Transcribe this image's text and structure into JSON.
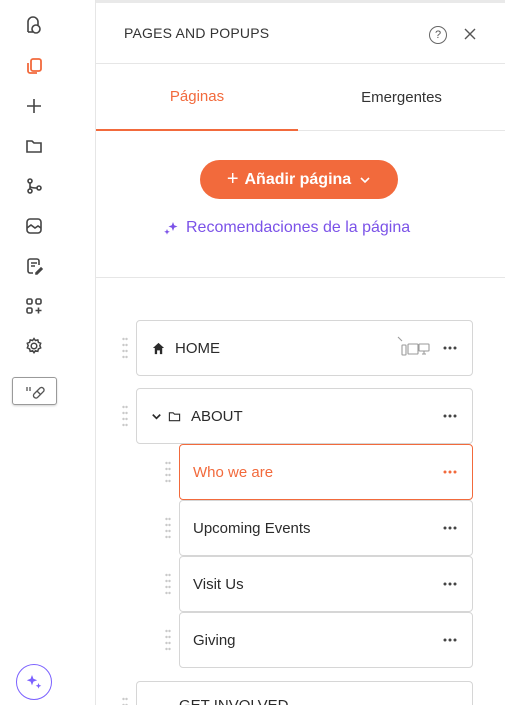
{
  "panel": {
    "title": "PAGES AND POPUPS",
    "help_glyph": "?",
    "tabs": [
      {
        "label": "Páginas",
        "active": true
      },
      {
        "label": "Emergentes",
        "active": false
      }
    ],
    "add_page_label": "Añadir página",
    "add_page_plus": "+",
    "recommendations_label": "Recomendaciones de la página"
  },
  "rail": {
    "icons": [
      "design-icon",
      "pages-icon",
      "add-icon",
      "folder-icon",
      "flow-icon",
      "media-icon",
      "blog-icon",
      "apps-icon",
      "settings-icon"
    ],
    "active_icon": "pages-icon",
    "plugin_chip_icon": "plugin-chip-icon",
    "ai_icon": "sparkle-icon"
  },
  "pages": [
    {
      "label": "HOME",
      "type": "home",
      "level": 0
    },
    {
      "label": "ABOUT",
      "type": "folder",
      "level": 0,
      "expanded": true
    },
    {
      "label": "Who we are",
      "type": "page",
      "level": 1,
      "active": true
    },
    {
      "label": "Upcoming Events",
      "type": "page",
      "level": 1
    },
    {
      "label": "Visit Us",
      "type": "page",
      "level": 1
    },
    {
      "label": "Giving",
      "type": "page",
      "level": 1
    },
    {
      "label": "GET INVOLVED",
      "type": "folder",
      "level": 0,
      "partially_visible": true
    }
  ],
  "colors": {
    "accent": "#f26a3c",
    "ai_purple": "#7b52e8",
    "border": "#d6d6d6",
    "text": "#2b2b2b"
  }
}
